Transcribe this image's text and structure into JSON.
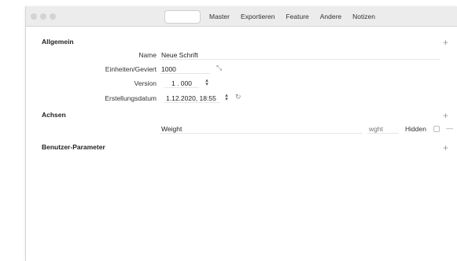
{
  "toolbar": {
    "tabs": [
      {
        "label": ""
      },
      {
        "label": "Master"
      },
      {
        "label": "Exportieren"
      },
      {
        "label": "Feature"
      },
      {
        "label": "Andere"
      },
      {
        "label": "Notizen"
      }
    ]
  },
  "sections": {
    "general": {
      "title": "Allgemein",
      "name_label": "Name",
      "name_value": "Neue Schrift",
      "upm_label": "Einheiten/Geviert",
      "upm_value": "1000",
      "version_label": "Version",
      "version_value": "1 . 000",
      "date_label": "Erstellungsdatum",
      "date_value": "1.12.2020, 18:55"
    },
    "axes": {
      "title": "Achsen",
      "axis_name": "Weight",
      "axis_tag_placeholder": "wght",
      "hidden_label": "Hidden"
    },
    "custom_params": {
      "title": "Benutzer-Parameter"
    }
  },
  "icons": {
    "plus": "+",
    "minus": "—",
    "resize": "⤡",
    "refresh": "↻",
    "stepper_up": "▴",
    "stepper_down": "▾"
  }
}
